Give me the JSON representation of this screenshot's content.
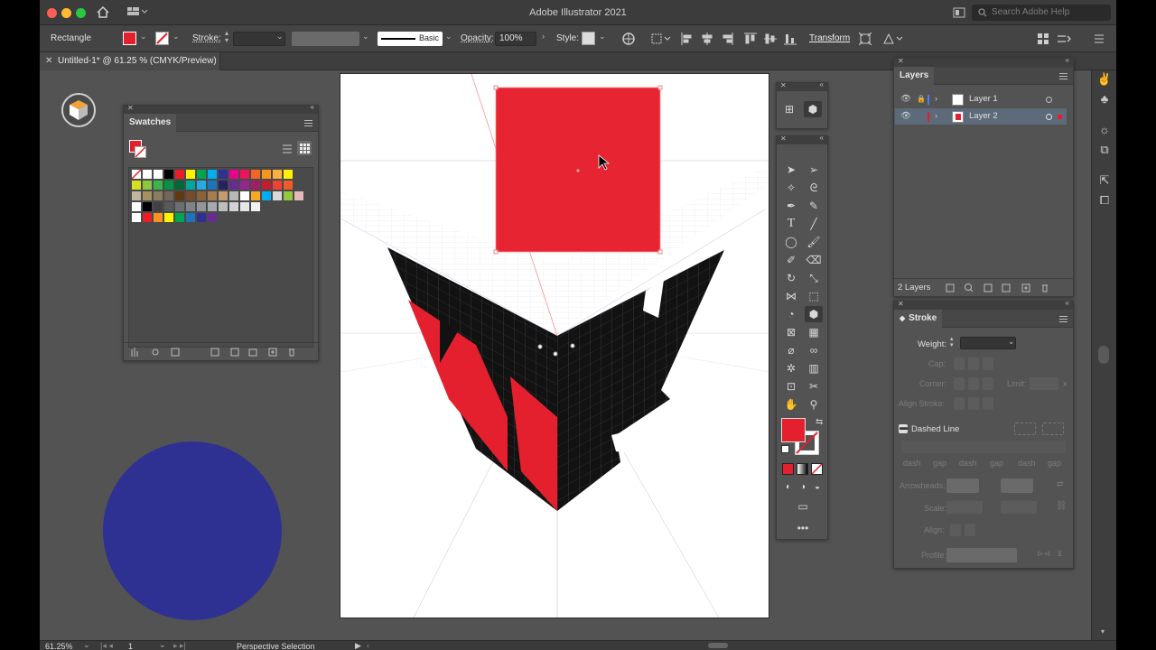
{
  "app": {
    "title": "Adobe Illustrator 2021",
    "search_placeholder": "Search Adobe Help"
  },
  "control_bar": {
    "selection_type": "Rectangle",
    "fill_color": "#e5202e",
    "stroke_label": "Stroke:",
    "stroke_value": "",
    "brush_label": "Basic",
    "opacity_label": "Opacity:",
    "opacity_value": "100%",
    "style_label": "Style:",
    "transform_label": "Transform"
  },
  "document": {
    "tab_label": "Untitled-1* @ 61.25 % (CMYK/Preview)"
  },
  "swatches": {
    "title": "Swatches",
    "rows": [
      [
        "#ffffff",
        "#ffffff",
        "#ffffff",
        "#000000",
        "#ed1c24",
        "#fff200",
        "#00a651",
        "#00aeef",
        "#2e3192",
        "#ec008c",
        "#ed145b",
        "#f26522",
        "#f7941d",
        "#fbb040",
        "#fff200"
      ],
      [
        "#d7df23",
        "#8dc63f",
        "#39b54a",
        "#009444",
        "#006838",
        "#00a79d",
        "#27aae1",
        "#1c75bc",
        "#262262",
        "#662d91",
        "#92278f",
        "#9e1f63",
        "#be1e2d",
        "#ef4136",
        "#f15a29"
      ],
      [
        "#c2b59b",
        "#a39161",
        "#8b7d5c",
        "#726658",
        "#603913",
        "#754c29",
        "#8c6239",
        "#a97c50",
        "#c69c6d",
        "#b8b8b8",
        "#ffffff",
        "#f9a825",
        "#00aeef",
        "#d8d8d8",
        "#92c83e",
        "#e6b8b8"
      ],
      [
        "#ffffff",
        "#000000",
        "#414042",
        "#58595b",
        "#6d6e71",
        "#808285",
        "#939598",
        "#a7a9ac",
        "#bcbec0",
        "#d1d3d4",
        "#e6e7e8",
        "#f1f2f2"
      ],
      [
        "#ffffff",
        "#ed1c24",
        "#f7941d",
        "#fff200",
        "#00a651",
        "#1c75bc",
        "#2e3192",
        "#662d91"
      ]
    ]
  },
  "layers": {
    "title": "Layers",
    "items": [
      {
        "name": "Layer 1",
        "color": "#4f7df5"
      },
      {
        "name": "Layer 2",
        "color": "#e5202e"
      }
    ],
    "count_label": "2 Layers"
  },
  "stroke_panel": {
    "title": "Stroke",
    "weight_label": "Weight:",
    "cap_label": "Cap:",
    "corner_label": "Corner:",
    "limit_label": "Limit:",
    "limit_x": "x",
    "align_label": "Align Stroke:",
    "dashed_label": "Dashed Line",
    "dash_labels": [
      "dash",
      "gap",
      "dash",
      "gap",
      "dash",
      "gap"
    ],
    "arrowheads_label": "Arrowheads:",
    "scale_label": "Scale:",
    "align2_label": "Align:",
    "profile_label": "Profile:"
  },
  "status": {
    "zoom": "61.25%",
    "artboard": "1",
    "tool": "Perspective Selection"
  },
  "colors": {
    "red": "#e5202e",
    "blue": "#2e3192",
    "panel_bg": "#535353"
  }
}
